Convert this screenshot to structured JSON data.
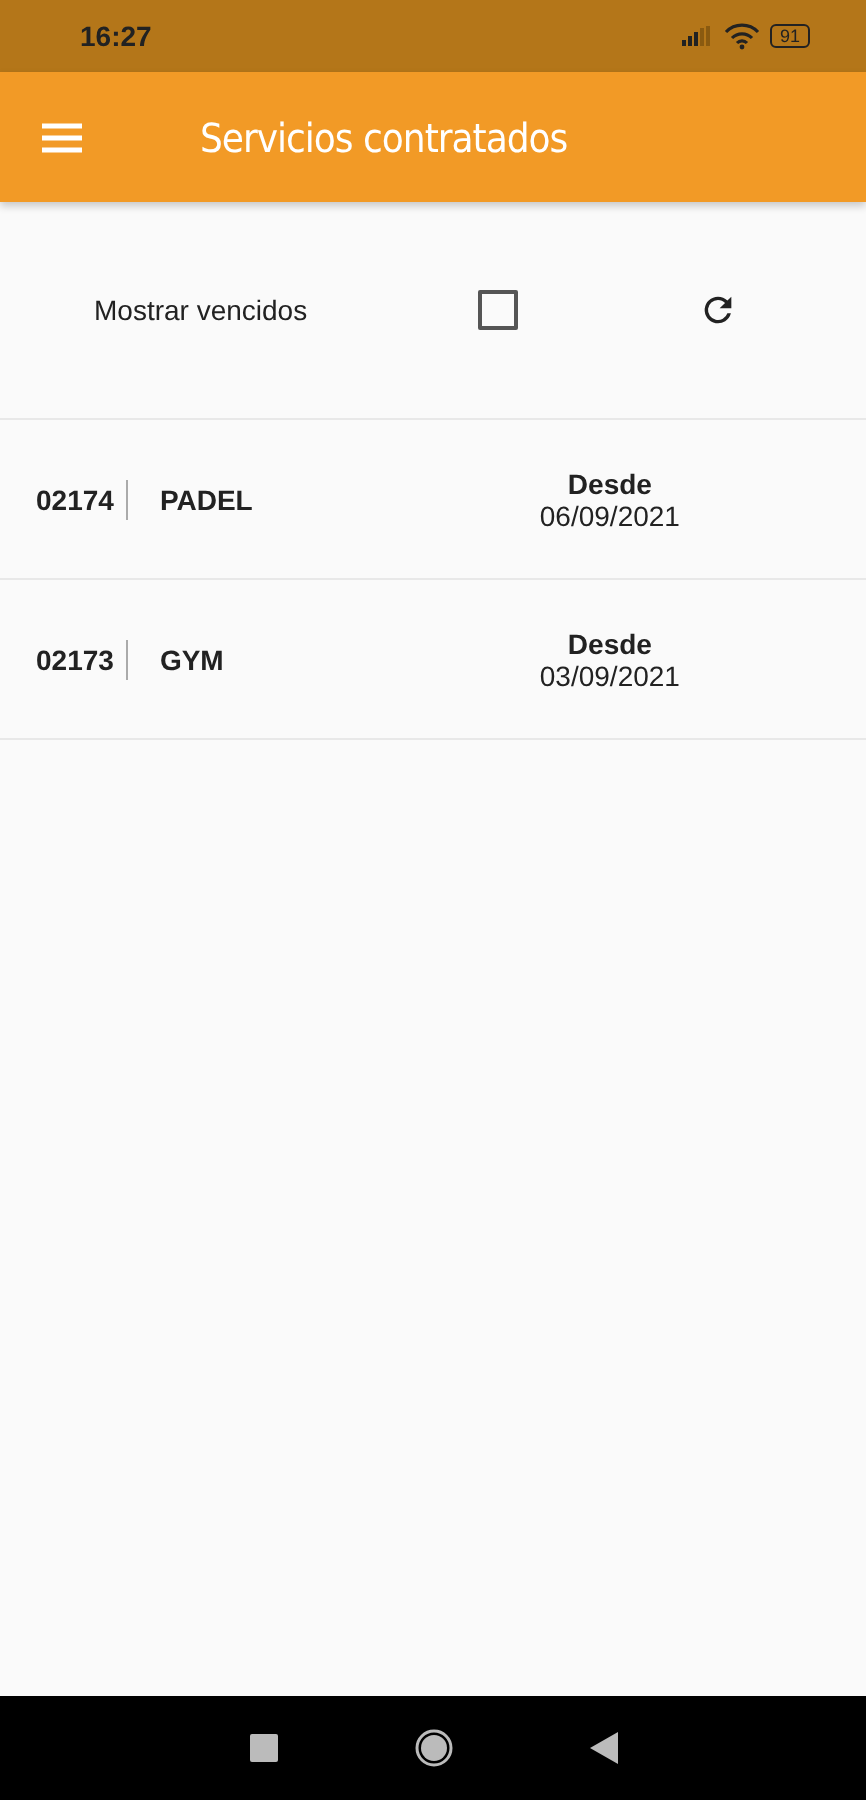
{
  "status_bar": {
    "time": "16:27",
    "battery": "91"
  },
  "app_bar": {
    "title": "Servicios contratados"
  },
  "filter": {
    "label": "Mostrar vencidos",
    "checked": false
  },
  "services": [
    {
      "code": "02174",
      "name": "PADEL",
      "since_label": "Desde",
      "since_date": "06/09/2021"
    },
    {
      "code": "02173",
      "name": "GYM",
      "since_label": "Desde",
      "since_date": "03/09/2021"
    }
  ]
}
